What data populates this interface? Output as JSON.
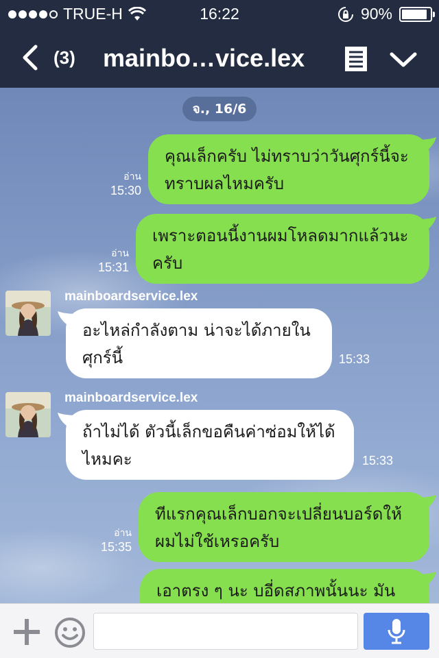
{
  "status_bar": {
    "carrier": "TRUE-H",
    "time": "16:22",
    "battery": "90%",
    "battery_level": 0.9,
    "signal_bars": 4,
    "signal_max": 5
  },
  "nav": {
    "unread_count": "(3)",
    "title": "mainbo…vice.lex"
  },
  "chat": {
    "date_label": "จ., 16/6",
    "messages": [
      {
        "direction": "sent",
        "text": "คุณเล็กครับ ไม่ทราบว่าวันศุกร์นี้จะทราบผลไหมครับ",
        "read_label": "อ่าน",
        "time": "15:30"
      },
      {
        "direction": "sent",
        "text": "เพราะตอนนี้งานผมโหลดมากแล้วนะครับ",
        "read_label": "อ่าน",
        "time": "15:31"
      },
      {
        "direction": "received",
        "sender": "mainboardservice.lex",
        "text": "อะไหล่กำลังตาม น่าจะได้ภายในศุกร์นี้",
        "time": "15:33"
      },
      {
        "direction": "received",
        "sender": "mainboardservice.lex",
        "text": "ถ้าไม่ได้ ตัวนี้เล็กขอคืนค่าซ่อมให้ได้ไหมคะ",
        "time": "15:33"
      },
      {
        "direction": "sent",
        "text": "ทีแรกคุณเล็กบอกจะเปลี่ยนบอร์ดให้ผมไม่ใช้เหรอครับ",
        "read_label": "อ่าน",
        "time": "15:35"
      },
      {
        "direction": "sent",
        "text": "เอาตรง ๆ นะ บอี่ดสภาพนั้นนะ มัน",
        "read_label": "",
        "time": ""
      }
    ]
  },
  "input": {
    "placeholder": ""
  },
  "icons": {
    "back": "chevron-left-icon",
    "notes": "notes-icon",
    "expand": "chevron-down-icon",
    "wifi": "wifi-icon",
    "rotation_lock": "rotation-lock-icon",
    "add": "plus-icon",
    "emoji": "smiley-icon",
    "mic": "microphone-icon"
  },
  "colors": {
    "header": "#232c40",
    "sent_bubble": "#86df4e",
    "received_bubble": "#ffffff",
    "mic_button": "#5686e6"
  }
}
